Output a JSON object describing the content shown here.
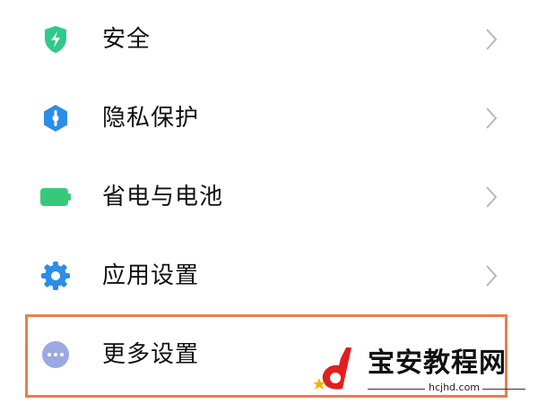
{
  "settings": {
    "items": [
      {
        "label": "安全",
        "icon": "shield-icon",
        "color": "#2fc98b"
      },
      {
        "label": "隐私保护",
        "icon": "privacy-icon",
        "color": "#2b8de9"
      },
      {
        "label": "省电与电池",
        "icon": "battery-icon",
        "color": "#36c97c"
      },
      {
        "label": "应用设置",
        "icon": "gear-icon",
        "color": "#2b8de9"
      },
      {
        "label": "更多设置",
        "icon": "more-icon",
        "color": "#9ba9e0"
      }
    ]
  },
  "highlight_color": "#e87d4c",
  "watermark": {
    "title": "宝安教程网",
    "domain": "hcjhd.com",
    "logo_color": "#e0201f",
    "star_color": "#f5b400"
  }
}
